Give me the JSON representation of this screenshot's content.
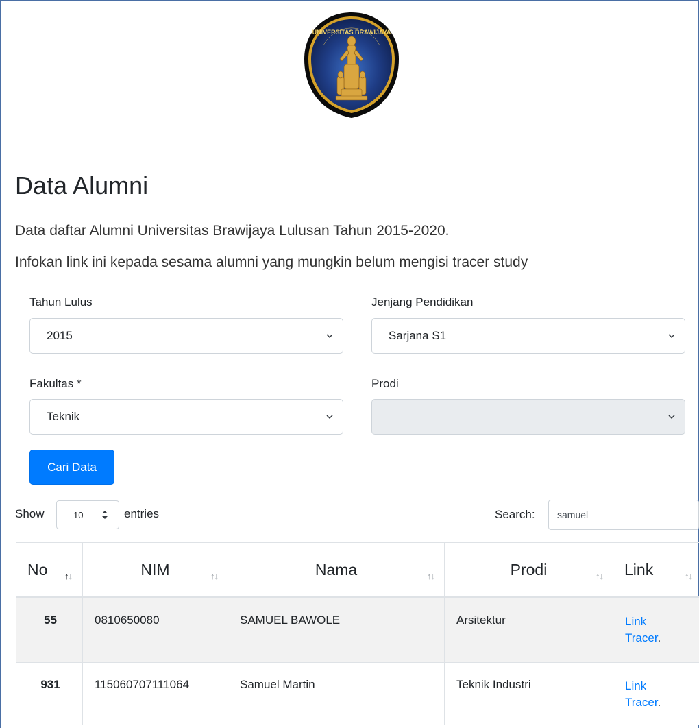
{
  "logo": {
    "icon": "university-seal",
    "text": "UNIVERSITAS BRAWIJAYA"
  },
  "page": {
    "title": "Data Alumni",
    "description_line1": "Data daftar Alumni Universitas Brawijaya Lulusan Tahun 2015-2020.",
    "description_line2": "Infokan link ini kepada sesama alumni yang mungkin belum mengisi tracer study"
  },
  "filters": {
    "tahun_lulus": {
      "label": "Tahun Lulus",
      "value": "2015"
    },
    "jenjang": {
      "label": "Jenjang Pendidikan",
      "value": "Sarjana S1"
    },
    "fakultas": {
      "label": "Fakultas *",
      "value": "Teknik"
    },
    "prodi": {
      "label": "Prodi",
      "value": ""
    },
    "submit_label": "Cari Data"
  },
  "table_controls": {
    "show_label": "Show",
    "length_value": "10",
    "entries_label": "entries",
    "search_label": "Search:",
    "search_value": "samuel"
  },
  "table": {
    "columns": [
      "No",
      "NIM",
      "Nama",
      "Prodi",
      "Link"
    ],
    "rows": [
      {
        "no": "55",
        "nim": "0810650080",
        "nama": "SAMUEL BAWOLE",
        "prodi": "Arsitektur",
        "link_line1": "Link",
        "link_line2": "Tracer",
        "link_suffix": "."
      },
      {
        "no": "931",
        "nim": "115060707111064",
        "nama": "Samuel Martin",
        "prodi": "Teknik Industri",
        "link_line1": "Link",
        "link_line2": "Tracer",
        "link_suffix": "."
      }
    ]
  },
  "colors": {
    "primary": "#007bff",
    "seal_navy": "#1a2f6b",
    "seal_gold": "#d4a12a"
  }
}
